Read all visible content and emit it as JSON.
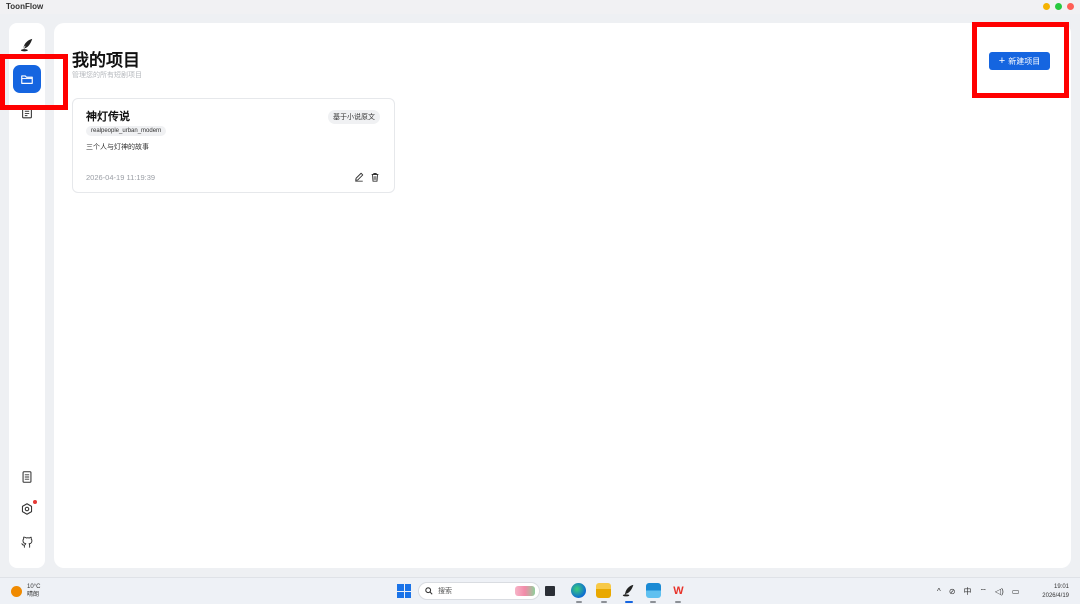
{
  "app": {
    "title": "ToonFlow"
  },
  "window_controls": [
    {
      "name": "minimize",
      "color": "#f5b301"
    },
    {
      "name": "maximize",
      "color": "#27c93f"
    },
    {
      "name": "close",
      "color": "#ff5f56"
    }
  ],
  "colors": {
    "accent": "#1565e0",
    "highlight": "#ff0000"
  },
  "sidebar": {
    "items": [
      {
        "icon": "quill-logo-icon"
      },
      {
        "icon": "folder-icon",
        "active": true
      },
      {
        "icon": "list-icon"
      }
    ],
    "bottom_items": [
      {
        "icon": "document-icon"
      },
      {
        "icon": "settings-icon",
        "has_notification": true
      },
      {
        "icon": "github-icon"
      }
    ]
  },
  "main": {
    "title": "我的项目",
    "subtitle": "管理您的所有短剧项目",
    "new_button_label": "新建项目"
  },
  "projects": [
    {
      "title": "神灯传说",
      "badge": "基于小说原文",
      "tag": "realpeople_urban_modern",
      "description": "三个人与灯神的故事",
      "date": "2026-04-19 11:19:39"
    }
  ],
  "taskbar": {
    "weather": {
      "temp": "10°C",
      "condition": "晴朗"
    },
    "search_placeholder": "搜索",
    "tray": {
      "ime": "中"
    },
    "clock": {
      "time": "19:01",
      "date": "2026/4/19"
    }
  }
}
